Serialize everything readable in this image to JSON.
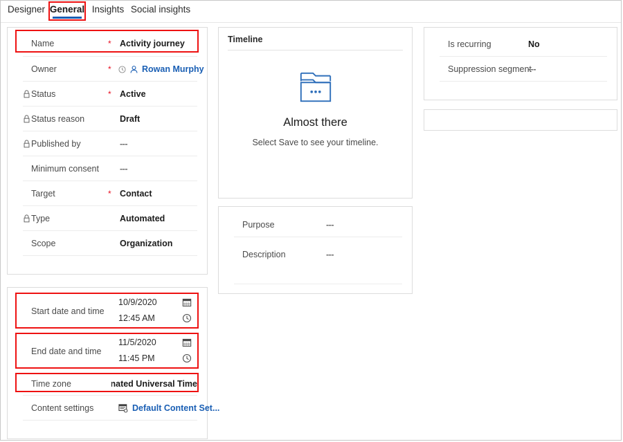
{
  "tabs": [
    {
      "label": "Designer",
      "active": false
    },
    {
      "label": "General",
      "active": true
    },
    {
      "label": "Insights",
      "active": false
    },
    {
      "label": "Social insights",
      "active": false
    }
  ],
  "colors": {
    "highlight": "#ee1111",
    "accent": "#1a5fb4",
    "required": "#e81123",
    "panel_border": "#dcdcdc"
  },
  "summary_panel": {
    "fields": [
      {
        "label": "Name",
        "value": "Activity journey",
        "required": true,
        "locked": false,
        "highlighted": true
      },
      {
        "label": "Owner",
        "value": "Rowan Murphy",
        "required": true,
        "locked": false,
        "kind": "owner"
      },
      {
        "label": "Status",
        "value": "Active",
        "required": true,
        "locked": true
      },
      {
        "label": "Status reason",
        "value": "Draft",
        "required": false,
        "locked": true
      },
      {
        "label": "Published by",
        "value": "---",
        "required": false,
        "locked": true,
        "muted": true
      },
      {
        "label": "Minimum consent",
        "value": "---",
        "required": false,
        "locked": false,
        "muted": true
      },
      {
        "label": "Target",
        "value": "Contact",
        "required": true,
        "locked": false
      },
      {
        "label": "Type",
        "value": "Automated",
        "required": false,
        "locked": true
      },
      {
        "label": "Scope",
        "value": "Organization",
        "required": false,
        "locked": false
      }
    ]
  },
  "schedule_panel": {
    "start": {
      "label": "Start date and time",
      "date": "10/9/2020",
      "time": "12:45 AM",
      "highlighted": true
    },
    "end": {
      "label": "End date and time",
      "date": "11/5/2020",
      "time": "11:45 PM",
      "highlighted": true
    },
    "time_zone": {
      "label": "Time zone",
      "value": "(GMT) Coordinated Universal Time",
      "highlighted": true
    },
    "content_settings": {
      "label": "Content settings",
      "value": "Default Content Set..."
    }
  },
  "timeline_panel": {
    "title": "Timeline",
    "empty_heading": "Almost there",
    "empty_subtext": "Select Save to see your timeline."
  },
  "purpose_panel": {
    "fields": [
      {
        "label": "Purpose",
        "value": "---"
      },
      {
        "label": "Description",
        "value": "---"
      }
    ]
  },
  "recurrence_panel": {
    "fields": [
      {
        "label": "Is recurring",
        "value": "No"
      },
      {
        "label": "Suppression segment",
        "value": "---",
        "muted": true
      }
    ]
  }
}
